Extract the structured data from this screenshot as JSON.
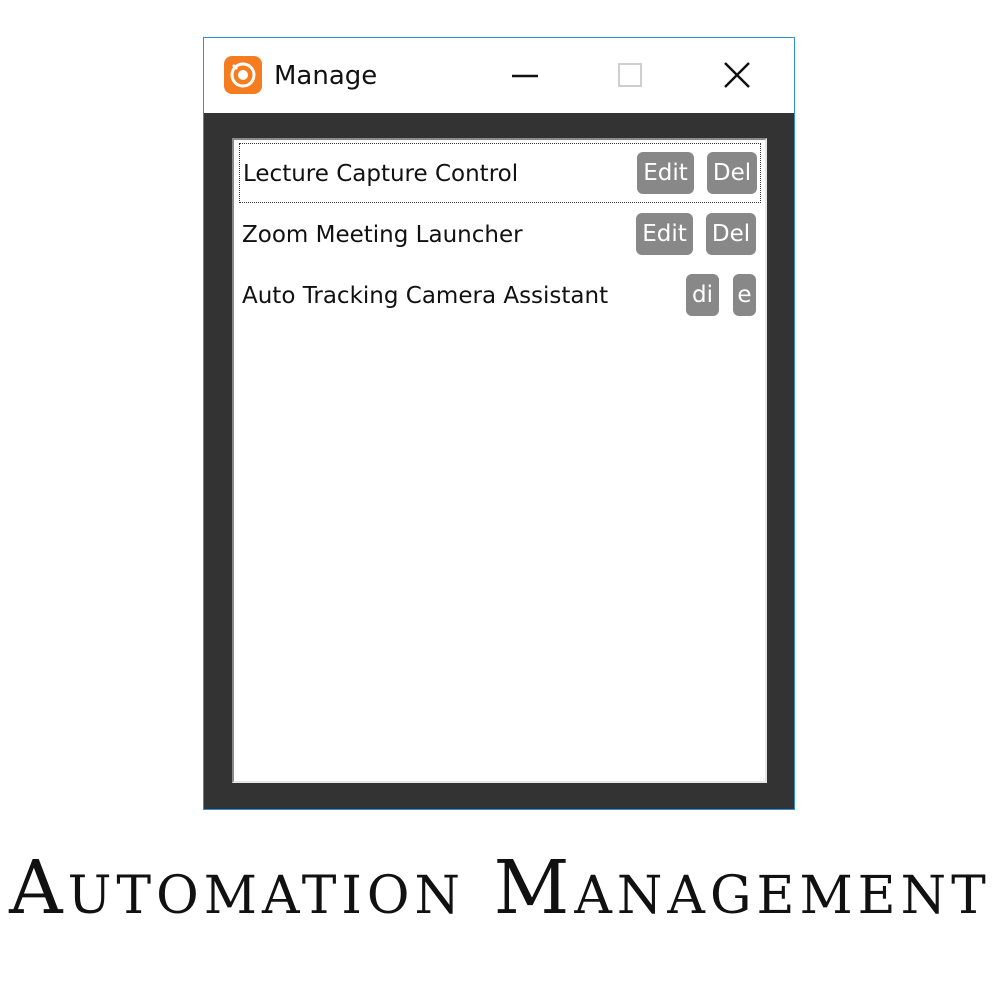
{
  "window": {
    "title": "Manage",
    "app_icon": "orange-app-icon",
    "controls": {
      "minimize_icon": "minimize-icon",
      "maximize_icon": "maximize-icon",
      "close_icon": "close-icon"
    }
  },
  "list": {
    "items": [
      {
        "label": "Lecture Capture Control",
        "edit_label": "Edit",
        "delete_label": "Del",
        "focused": true
      },
      {
        "label": "Zoom Meeting Launcher",
        "edit_label": "Edit",
        "delete_label": "Del",
        "focused": false
      },
      {
        "label": "Auto Tracking Camera Assistant",
        "edit_label": "di",
        "delete_label": "e",
        "focused": false
      }
    ]
  },
  "caption": "Automation Management",
  "colors": {
    "accent_border": "#2f8fd8",
    "app_icon": "#f57c1f",
    "button_bg": "#888888",
    "window_bg": "#333333"
  }
}
